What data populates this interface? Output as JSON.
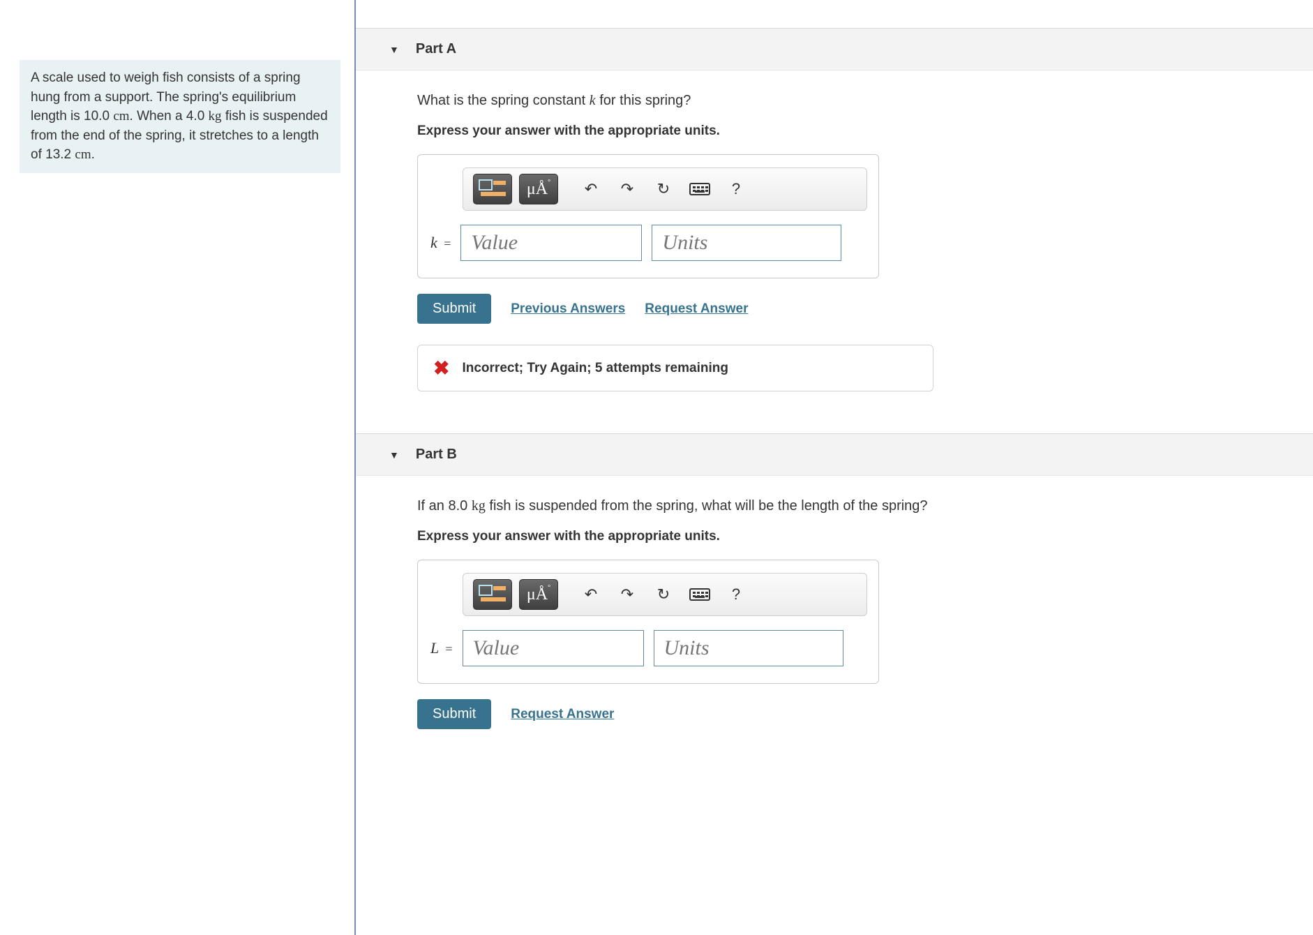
{
  "problem_text_html": "A scale used to weigh fish consists of a spring hung from a support. The spring's equilibrium length is 10.0 <span class='rm'>cm</span>. When a 4.0 <span class='rm'>kg</span> fish is suspended from the end of the spring, it stretches to a length of 13.2 <span class='rm'>cm</span>.",
  "partA": {
    "title": "Part A",
    "question_html": "What is the spring constant <span class='mathvar'>k</span> for this spring?",
    "instruction": "Express your answer with the appropriate units.",
    "var_label_html": "<span>k</span> <span class='eq'>=</span>",
    "value_placeholder": "Value",
    "units_placeholder": "Units",
    "submit": "Submit",
    "prev_answers": "Previous Answers",
    "request_answer": "Request Answer",
    "feedback": "Incorrect; Try Again; 5 attempts remaining"
  },
  "partB": {
    "title": "Part B",
    "question_html": "If an 8.0 <span class='rm'>kg</span> fish is suspended from the spring, what will be the length of the spring?",
    "instruction": "Express your answer with the appropriate units.",
    "var_label_html": "<span>L</span> <span class='eq'>=</span>",
    "value_placeholder": "Value",
    "units_placeholder": "Units",
    "submit": "Submit",
    "request_answer": "Request Answer"
  },
  "toolbar": {
    "units_label": "μÅ",
    "help": "?"
  }
}
